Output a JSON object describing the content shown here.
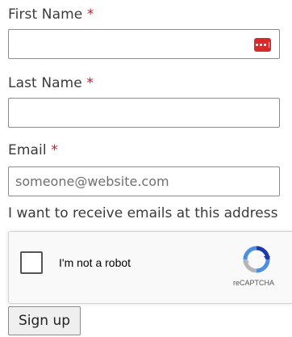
{
  "form": {
    "first_name": {
      "label": "First Name",
      "required_mark": "*"
    },
    "last_name": {
      "label": "Last Name",
      "required_mark": "*"
    },
    "email": {
      "label": "Email",
      "required_mark": "*",
      "placeholder": "someone@website.com"
    },
    "consent_text": "I want to receive emails at this address",
    "submit_label": "Sign up"
  },
  "captcha": {
    "checkbox_label": "I'm not a robot",
    "brand": "reCAPTCHA",
    "checked": false
  },
  "colors": {
    "required": "#d0142c",
    "password_manager": "#d72b2b",
    "captcha_blue": "#4a90e2",
    "captcha_gray": "#b5b5b5"
  },
  "icons": {
    "password_manager": "password-manager-icon",
    "captcha_logo": "recaptcha-logo-icon"
  }
}
